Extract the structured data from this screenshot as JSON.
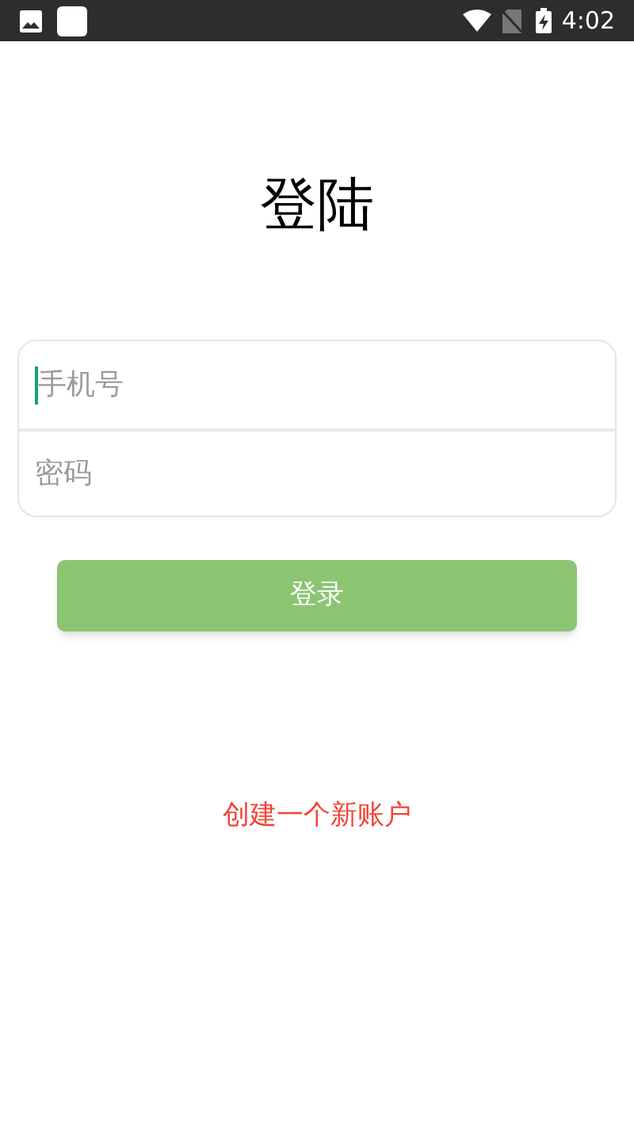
{
  "status_bar": {
    "time": "4:02"
  },
  "title": "登陆",
  "fields": [
    {
      "placeholder": "手机号",
      "focused": true
    },
    {
      "placeholder": "密码",
      "focused": false
    }
  ],
  "login_button": "登录",
  "register_link": "创建一个新账户"
}
